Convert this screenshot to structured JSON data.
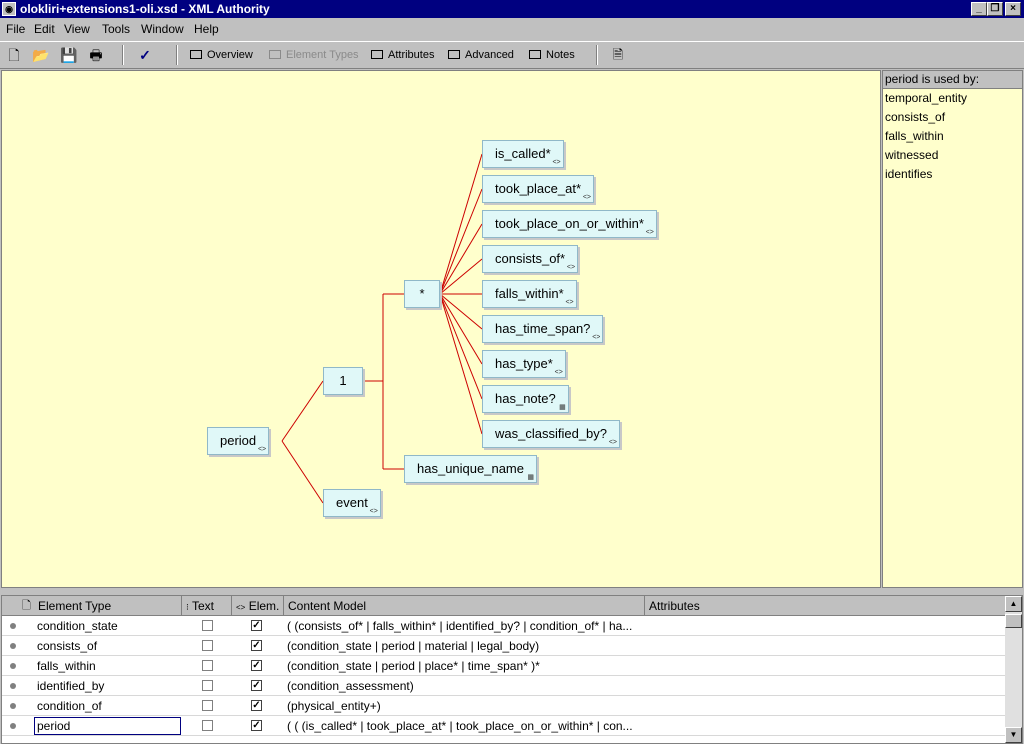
{
  "window": {
    "title": "olokliri+extensions1-oli.xsd - XML Authority",
    "minimize_glyph": "_",
    "maximize_glyph": "❐",
    "close_glyph": "×"
  },
  "menu": [
    "File",
    "Edit",
    "View",
    "Tools",
    "Window",
    "Help"
  ],
  "toolbar": {
    "icons": [
      "new-document-icon",
      "open-folder-icon",
      "save-icon",
      "print-icon",
      "check-icon"
    ],
    "buttons": [
      {
        "label": "Overview",
        "enabled": true
      },
      {
        "label": "Element Types",
        "enabled": false
      },
      {
        "label": "Attributes",
        "enabled": true
      },
      {
        "label": "Advanced",
        "enabled": true
      },
      {
        "label": "Notes",
        "enabled": true
      }
    ]
  },
  "diagram": {
    "root": {
      "label": "period"
    },
    "choice": {
      "label": "1"
    },
    "sequence": {
      "label": "*"
    },
    "children": [
      "is_called*",
      "took_place_at*",
      "took_place_on_or_within*",
      "consists_of*",
      "falls_within*",
      "has_time_span?",
      "has_type*",
      "has_note?",
      "was_classified_by?"
    ],
    "unique": "has_unique_name",
    "other": "event",
    "colors": {
      "line": "#cc0000",
      "node_fill": "#e0f8f8",
      "canvas": "#ffffcc"
    }
  },
  "used_by": {
    "header": "period is used by:",
    "items": [
      "temporal_entity",
      "consists_of",
      "falls_within",
      "witnessed",
      "identifies"
    ]
  },
  "table": {
    "headers": [
      "Element Type",
      "Text",
      "Elem.",
      "Content Model",
      "Attributes"
    ],
    "rows": [
      {
        "name": "condition_state",
        "text": false,
        "elem": true,
        "model": "( (consists_of* | falls_within* | identified_by? | condition_of* | ha..."
      },
      {
        "name": "consists_of",
        "text": false,
        "elem": true,
        "model": "(condition_state | period | material | legal_body)"
      },
      {
        "name": "falls_within",
        "text": false,
        "elem": true,
        "model": "(condition_state | period | place* | time_span* )*"
      },
      {
        "name": "identified_by",
        "text": false,
        "elem": true,
        "model": "(condition_assessment)"
      },
      {
        "name": "condition_of",
        "text": false,
        "elem": true,
        "model": "(physical_entity+)"
      },
      {
        "name": "period",
        "text": false,
        "elem": true,
        "model": "( ( (is_called* | took_place_at* | took_place_on_or_within* | con...",
        "editing": true
      }
    ],
    "check_glyph": "✓"
  }
}
